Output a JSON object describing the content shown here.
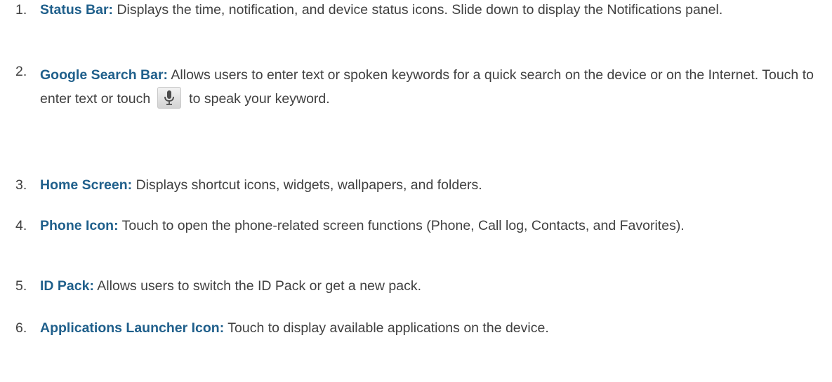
{
  "items": [
    {
      "number": "1.",
      "term": "Status Bar:",
      "text": "Displays the time, notification, and device status icons. Slide down to display the Notifications panel."
    },
    {
      "number": "2.",
      "term": "Google Search Bar:",
      "text_before_icon": "Allows users to enter text or spoken keywords for a quick search on the device or on the Internet. Touch to enter text or touch",
      "icon": "microphone-icon",
      "text_after_icon": "to speak your keyword."
    },
    {
      "number": "3.",
      "term": "Home Screen:",
      "text": "Displays shortcut icons, widgets, wallpapers, and folders."
    },
    {
      "number": "4.",
      "term": "Phone Icon:",
      "text": "Touch to open the phone-related screen functions (Phone, Call log, Contacts, and Favorites)."
    },
    {
      "number": "5.",
      "term": "ID Pack:",
      "text": "Allows users to switch the ID Pack or get a new pack."
    },
    {
      "number": "6.",
      "term": "Applications Launcher Icon:",
      "text": "Touch to display available applications on the device."
    }
  ],
  "colors": {
    "term": "#1f5f8b",
    "text": "#404040"
  }
}
